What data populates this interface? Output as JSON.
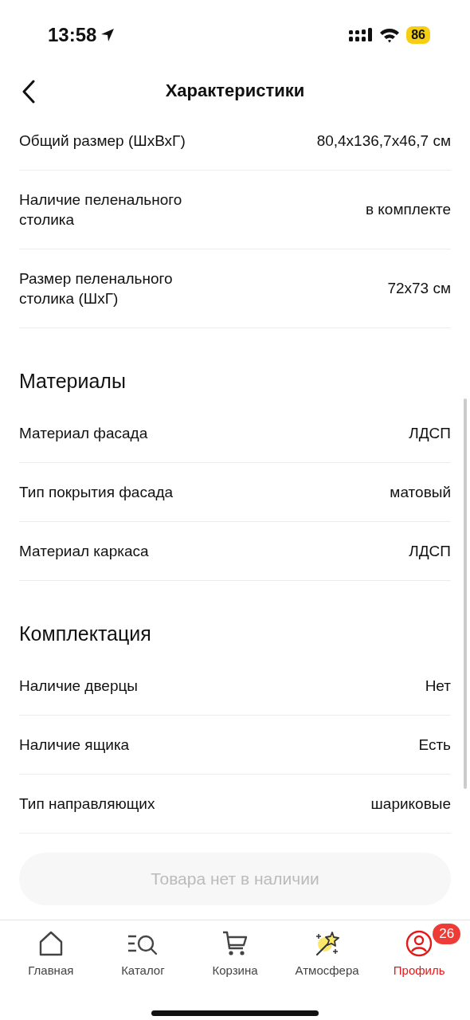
{
  "status_bar": {
    "time": "13:58",
    "battery": "86"
  },
  "header": {
    "title": "Характеристики"
  },
  "sections": [
    {
      "rows": [
        {
          "label": "Общий размер (ШхВхГ)",
          "value": "80,4x136,7x46,7 см"
        },
        {
          "label": "Наличие пеленального столика",
          "value": "в комплекте"
        },
        {
          "label": "Размер пеленального столика (ШхГ)",
          "value": "72x73 см"
        }
      ]
    },
    {
      "title": "Материалы",
      "rows": [
        {
          "label": "Материал фасада",
          "value": "ЛДСП"
        },
        {
          "label": "Тип покрытия фасада",
          "value": "матовый"
        },
        {
          "label": "Материал каркаса",
          "value": "ЛДСП"
        }
      ]
    },
    {
      "title": "Комплектация",
      "rows": [
        {
          "label": "Наличие дверцы",
          "value": "Нет"
        },
        {
          "label": "Наличие ящика",
          "value": "Есть"
        },
        {
          "label": "Тип направляющих",
          "value": "шариковые"
        }
      ]
    }
  ],
  "action_button": {
    "label": "Товара нет в наличии",
    "disabled": true
  },
  "tab_bar": [
    {
      "kind": "home",
      "label": "Главная",
      "selected": false
    },
    {
      "kind": "catalog",
      "label": "Каталог",
      "selected": false
    },
    {
      "kind": "cart",
      "label": "Корзина",
      "selected": false
    },
    {
      "kind": "magic",
      "label": "Атмосфера",
      "selected": false
    },
    {
      "kind": "profile",
      "label": "Профиль",
      "selected": true,
      "badge": "26"
    }
  ]
}
